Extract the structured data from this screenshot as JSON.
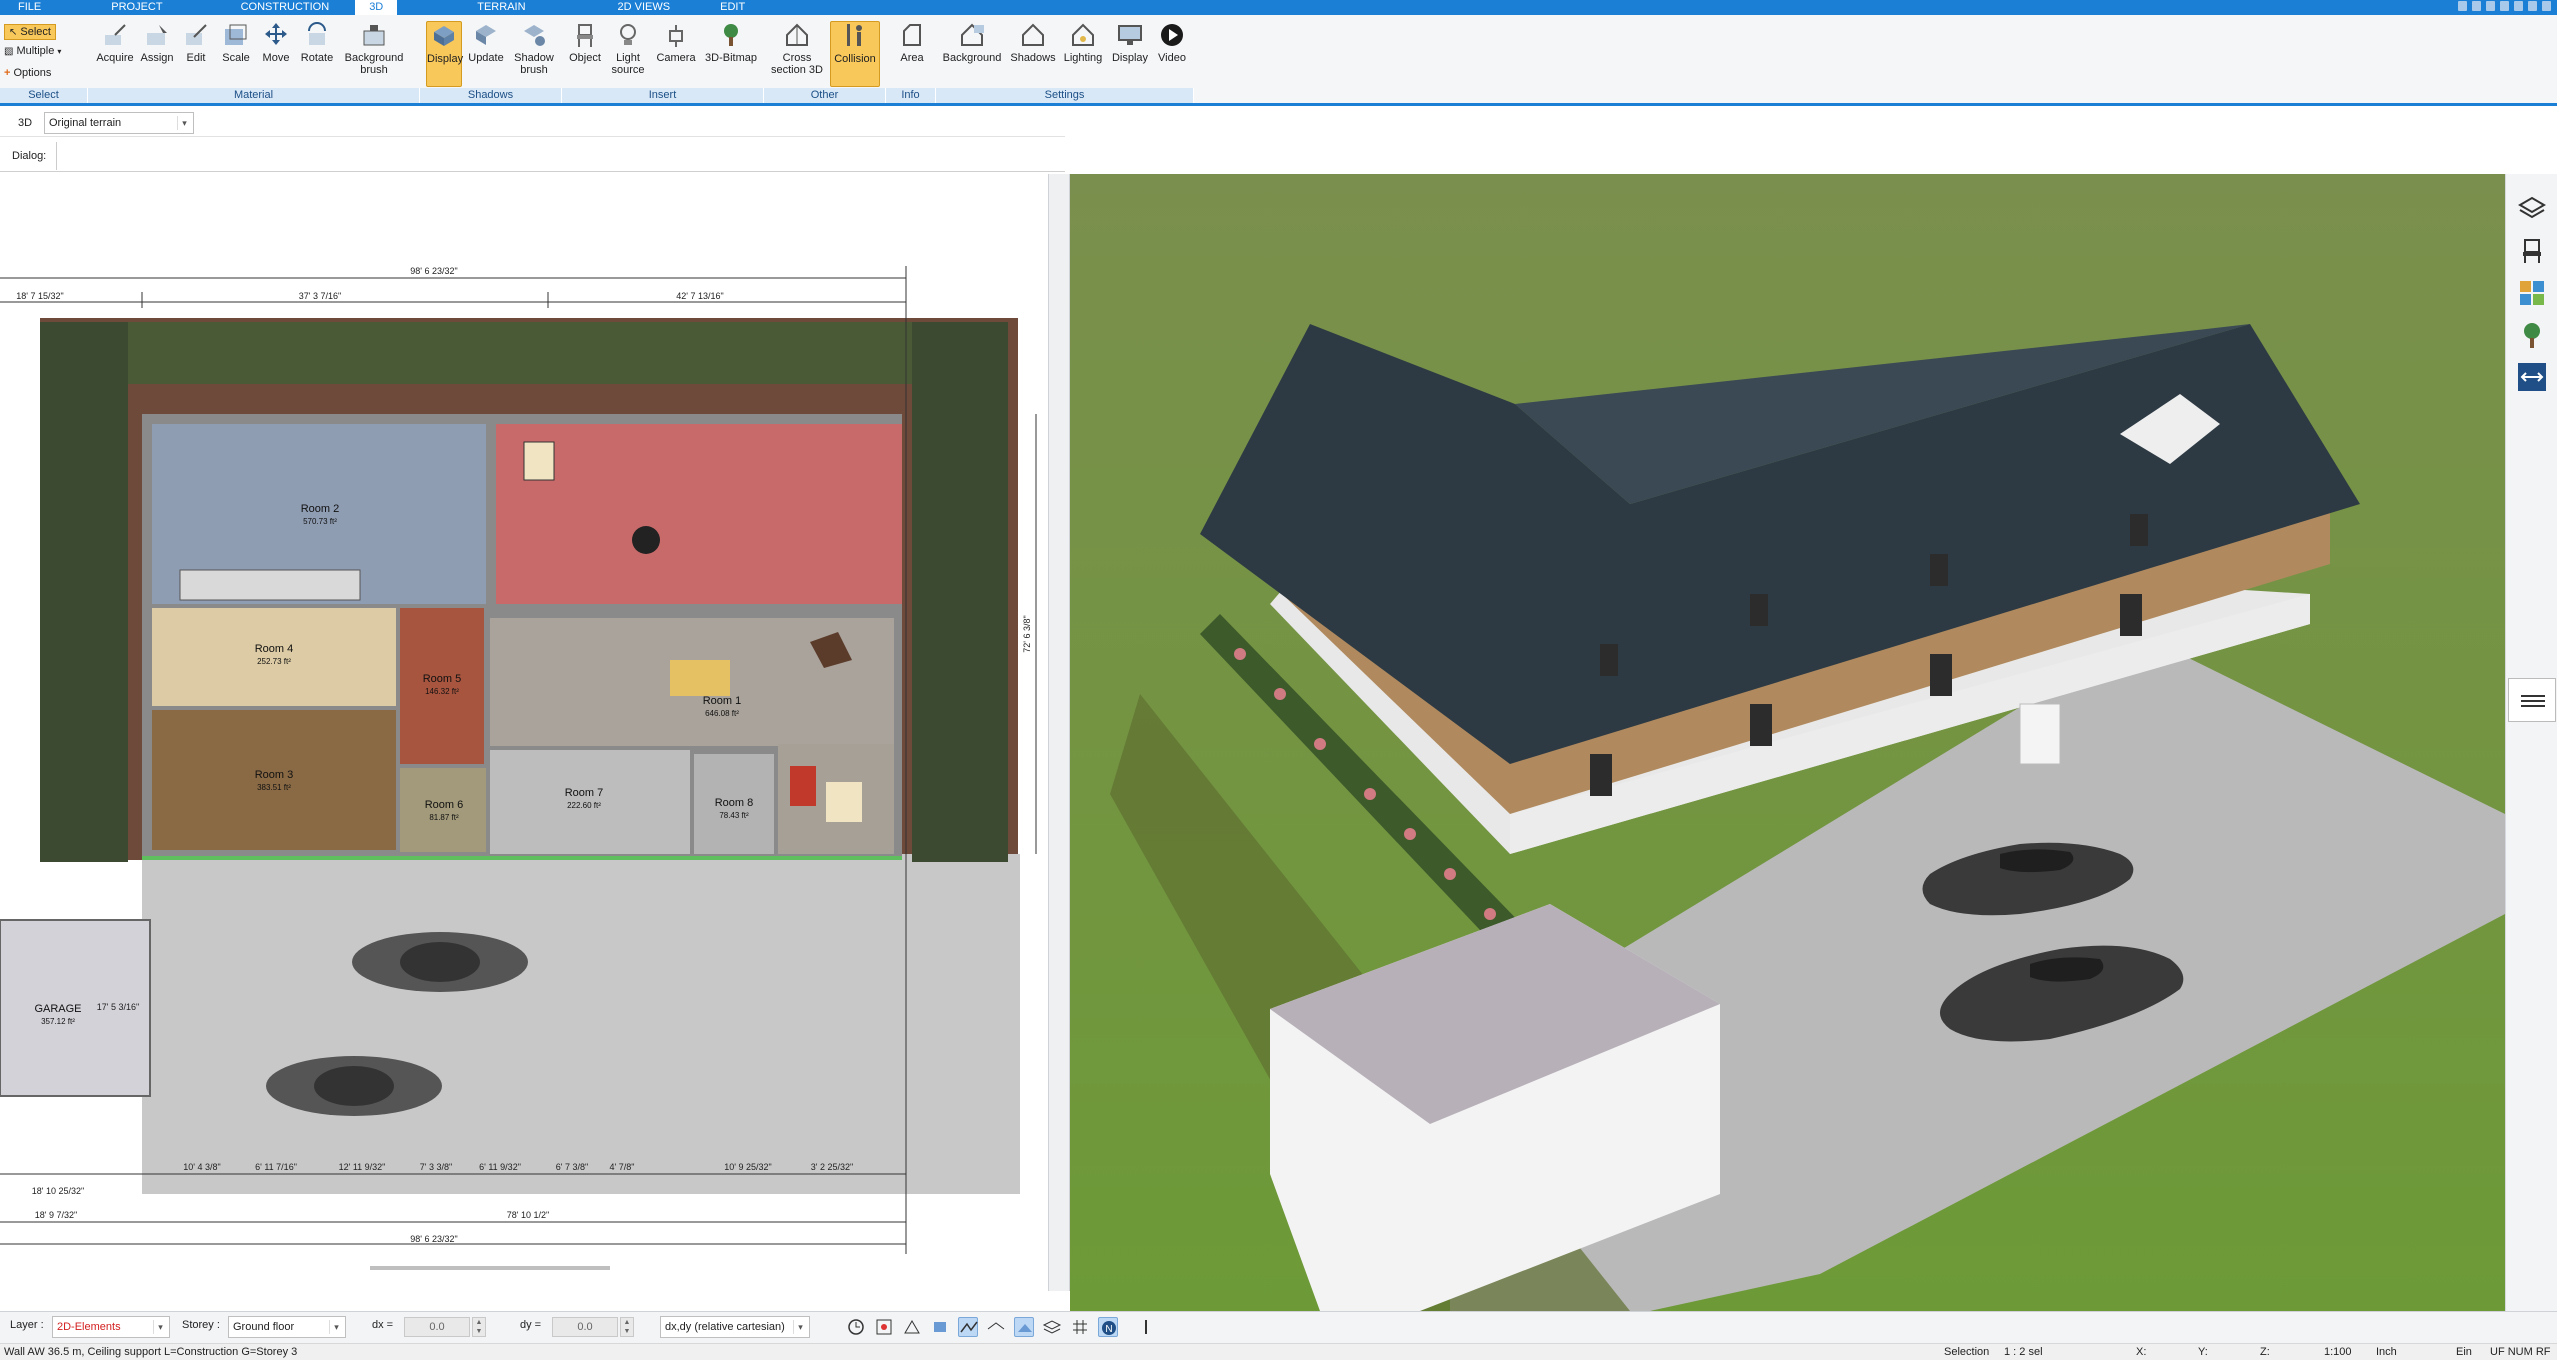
{
  "menu": {
    "tabs": [
      "FILE",
      "PROJECT",
      "CONSTRUCTION",
      "3D",
      "TERRAIN",
      "2D VIEWS",
      "EDIT"
    ],
    "active_tab": "3D"
  },
  "ribbon": {
    "select": {
      "select_label": "Select",
      "multiple_label": "Multiple",
      "options_label": "Options",
      "group_label": "Select"
    },
    "material": {
      "buttons": [
        "Acquire",
        "Assign",
        "Edit",
        "Scale",
        "Move",
        "Rotate",
        "Background brush"
      ],
      "group_label": "Material"
    },
    "shadows": {
      "buttons": [
        "Display",
        "Update",
        "Shadow brush"
      ],
      "group_label": "Shadows"
    },
    "insert": {
      "buttons": [
        "Object",
        "Light source",
        "Camera",
        "3D-Bitmap"
      ],
      "group_label": "Insert"
    },
    "other": {
      "buttons": [
        "Cross section 3D",
        "Collision"
      ],
      "group_label": "Other"
    },
    "info": {
      "buttons": [
        "Area"
      ],
      "group_label": "Info"
    },
    "settings": {
      "buttons": [
        "Background",
        "Shadows",
        "Lighting",
        "Display",
        "Video"
      ],
      "group_label": "Settings"
    }
  },
  "toolbar2": {
    "mode_label": "3D",
    "terrain_select": "Original terrain"
  },
  "toolbar3": {
    "dialog_label": "Dialog:"
  },
  "plan": {
    "rooms": [
      {
        "name": "Room 2",
        "area": "570.73 ft²"
      },
      {
        "name": "Room 4",
        "area": "252.73 ft²"
      },
      {
        "name": "Room 3",
        "area": "383.51 ft²"
      },
      {
        "name": "Room 5",
        "area": "146.32 ft²"
      },
      {
        "name": "Room 1",
        "area": "646.08 ft²"
      },
      {
        "name": "Room 6",
        "area": "81.87 ft²"
      },
      {
        "name": "Room 7",
        "area": "222.60 ft²"
      },
      {
        "name": "Room 8",
        "area": "78.43 ft²"
      },
      {
        "name": "GARAGE",
        "area": "357.12 ft²"
      }
    ],
    "dimensions": {
      "top_total": "98' 6 23/32\"",
      "top_left": "37' 3 7/16\"",
      "top_right": "42' 7 13/16\"",
      "top_left_small": "18' 7 15/32\"",
      "bottom_total": "98' 6 23/32\"",
      "bottom_mid": "78' 10 1/2\"",
      "bottom_left": "18' 9 7/32\"",
      "bottom_left2": "18' 10 25/32\"",
      "bottom_row": [
        "10' 4 3/8\"",
        "6' 11 7/16\"",
        "12' 11 9/32\"",
        "7' 3 3/8\"",
        "6' 11 9/32\"",
        "6' 7 3/8\"",
        "4' 7/8\"",
        "10' 9 25/32\"",
        "3' 2 25/32\""
      ],
      "right_side": "72' 6 3/8\"",
      "garage_dim": "17' 5 3/16\""
    }
  },
  "side_tools": [
    "layers-icon",
    "chair-icon",
    "materials-icon",
    "tree-icon",
    "link-icon"
  ],
  "bottom": {
    "layer_label": "Layer :",
    "layer_value": "2D-Elements",
    "storey_label": "Storey :",
    "storey_value": "Ground floor",
    "dx_label": "dx =",
    "dx_value": "0.0",
    "dy_label": "dy =",
    "dy_value": "0.0",
    "coord_mode": "dx,dy (relative cartesian)"
  },
  "status": {
    "message": "Wall AW 36.5 m, Ceiling support L=Construction G=Storey 3",
    "selection_label": "Selection",
    "selection_value": "1 : 2 sel",
    "x_label": "X:",
    "y_label": "Y:",
    "z_label": "Z:",
    "scale": "1:100",
    "unit": "Inch",
    "ein": "Ein",
    "flags": "UF NUM RF"
  },
  "colors": {
    "accent": "#1b7fd6",
    "active_button": "#f9c85a",
    "roof": "#2d3a44",
    "grass": "#6c8a3b"
  }
}
